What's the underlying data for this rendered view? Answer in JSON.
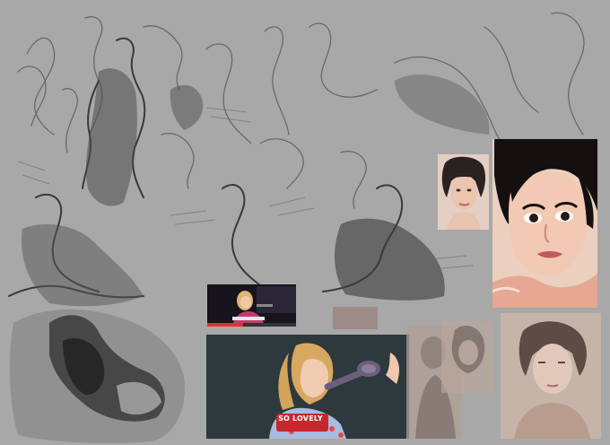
{
  "colors": {
    "background": "#a8a8a8",
    "sketch_line": "#4a4a4a",
    "sketch_dark": "#2b2b2b",
    "stage_bg": "#2e3a3d",
    "skin": "#f0cdb8",
    "hair_dark": "#1e1a1a",
    "hair_blonde": "#d6a861",
    "shirt_red": "#c9252c",
    "shirt_blue": "#9fb6d9",
    "microphone": "#6a5f7a"
  },
  "artwork": {
    "shirt_lettering": "SO LOVELY"
  }
}
